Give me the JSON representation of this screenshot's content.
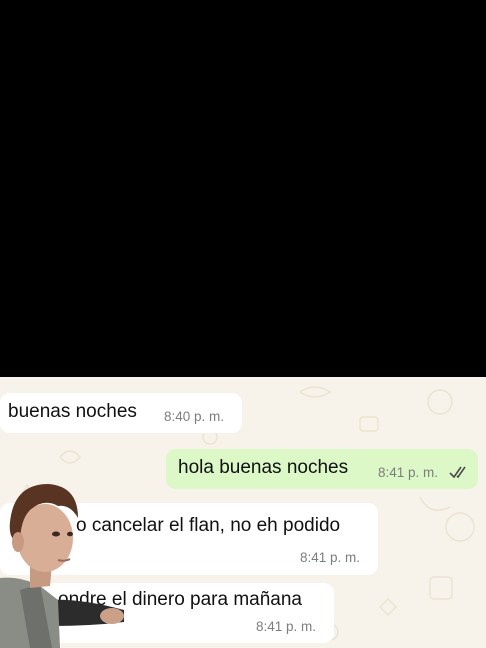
{
  "messages": [
    {
      "direction": "incoming",
      "text": "buenas noches",
      "time": "8:40 p. m."
    },
    {
      "direction": "outgoing",
      "text": "hola buenas noches",
      "time": "8:41 p. m.",
      "status": "read-double-check-icon"
    },
    {
      "direction": "incoming",
      "text": "o cancelar el flan, no eh podido",
      "time": "8:41 p. m."
    },
    {
      "direction": "incoming",
      "text": "ondre el dinero para mañana",
      "time": "8:41 p. m."
    }
  ],
  "colors": {
    "wallpaper": "#f7f3ea",
    "incoming_bubble": "#ffffff",
    "outgoing_bubble": "#dcf8c6",
    "read_ticks": "#4a4a4a"
  }
}
